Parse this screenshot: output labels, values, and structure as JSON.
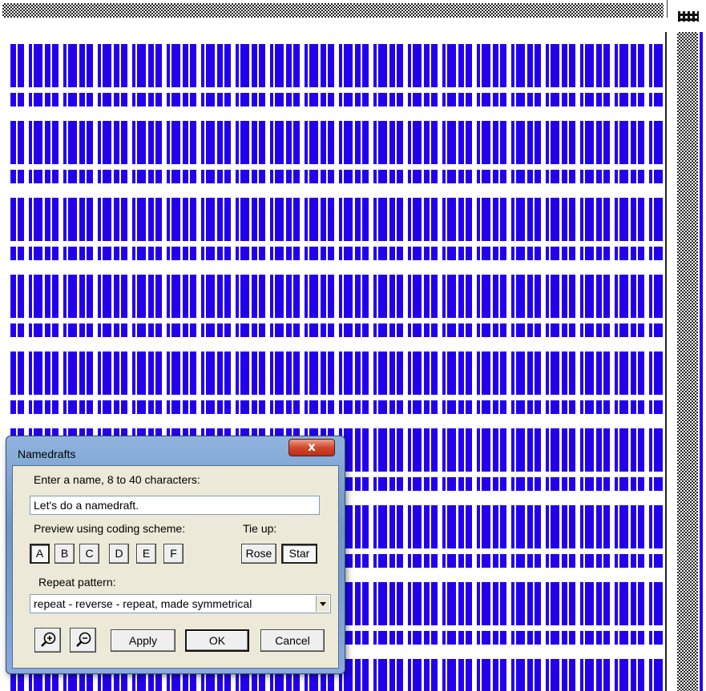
{
  "colors": {
    "drawdown_blue": "#2200ee",
    "treadling_bar": "#2a00f0"
  },
  "dialog": {
    "title": "Namedrafts",
    "close_glyph": "x",
    "name_prompt": "Enter a name, 8 to 40 characters:",
    "name_value": "Let's do a namedraft.",
    "preview_label": "Preview using coding scheme:",
    "tieup_label": "Tie up:",
    "schemes": [
      "A",
      "B",
      "C",
      "D",
      "E",
      "F"
    ],
    "selected_scheme": "A",
    "tieups": [
      "Rose",
      "Star"
    ],
    "selected_tieup": "Star",
    "repeat_label": "Repeat pattern:",
    "repeat_value": "repeat - reverse - repeat, made symmetrical",
    "zoom_in_icon": "zoom-in-icon",
    "zoom_out_icon": "zoom-out-icon",
    "apply_label": "Apply",
    "ok_label": "OK",
    "cancel_label": "Cancel"
  }
}
